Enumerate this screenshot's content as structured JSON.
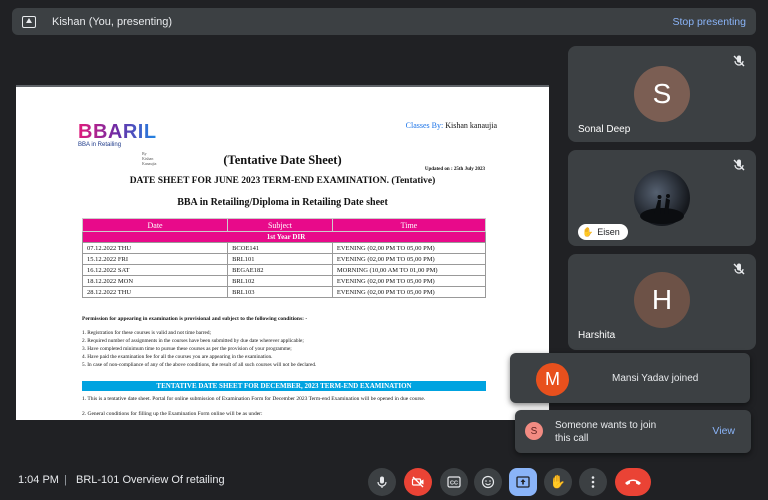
{
  "topbar": {
    "presenter": "Kishan (You, presenting)",
    "stop_label": "Stop presenting"
  },
  "document": {
    "logo_text": "BBARIL",
    "logo_sub": "BBA in Retailing",
    "logo_sub2": "By Kishan Kanaujia",
    "classes_by_label": "Classes By:",
    "classes_by_name": "Kishan kanaujia",
    "heading": "(Tentative Date Sheet)",
    "updated": "Updated on : 25th July 2023",
    "subheading": "DATE SHEET FOR JUNE 2023 TERM-END EXAMINATION. (Tentative)",
    "program": "BBA in Retailing/Diploma in Retailing Date sheet",
    "table": {
      "headers": [
        "Date",
        "Subject",
        "Time"
      ],
      "group": "1st Year DIR",
      "rows": [
        [
          "07.12.2022 THU",
          "BCOE141",
          "EVENING (02,00 PM TO 05,00 PM)"
        ],
        [
          "15.12.2022 FRI",
          "BRL101",
          "EVENING (02,00 PM TO 05,00 PM)"
        ],
        [
          "16.12.2022 SAT",
          "BEGAE182",
          "MORNING (10,00 AM TO 01,00 PM)"
        ],
        [
          "18.12.2022 MON",
          "BRL102",
          "EVENING (02,00 PM TO 05,00 PM)"
        ],
        [
          "28.12.2022 THU",
          "BRL103",
          "EVENING (02,00 PM TO 05,00 PM)"
        ]
      ]
    },
    "permission": "Permission for appearing in examination is provisional and subject to the following conditions: -",
    "conditions": [
      "1.  Registration for these courses is valid and not time barred;",
      "2.  Required number of assignments in the courses have been submitted by due date wherever applicable;",
      "3.  Have completed minimum time to pursue these courses as per the provision of your programme;",
      "4.  Have paid the examination fee for all the courses you are appearing in the examination.",
      "5.  In case of non-compliance of any of the above conditions, the result of all such courses will not be declared."
    ],
    "band": "TENTATIVE DATE SHEET FOR DECEMBER, 2023 TERM-END EXAMINATION",
    "note1": "1. This is a tentative date sheet. Portal for online submission of Examination Form for December 2023 Term-end Examination will be opened in due course.",
    "note2": "2. General conditions for filling up the Examination Form online will be as under:"
  },
  "participants": [
    {
      "name": "Sonal Deep",
      "initial": "S",
      "color": "#7b5e53"
    },
    {
      "name": "Eisen",
      "initial": ""
    },
    {
      "name": "Harshita",
      "initial": "H",
      "color": "#6d5247"
    }
  ],
  "toasts": {
    "joined": {
      "initial": "M",
      "message": "Mansi Yadav joined"
    },
    "request": {
      "initial": "S",
      "message": "Someone wants to join this call",
      "action": "View"
    }
  },
  "bottom": {
    "time": "1:04 PM",
    "separator": "|",
    "meeting": "BRL-101 Overview Of retailing"
  }
}
